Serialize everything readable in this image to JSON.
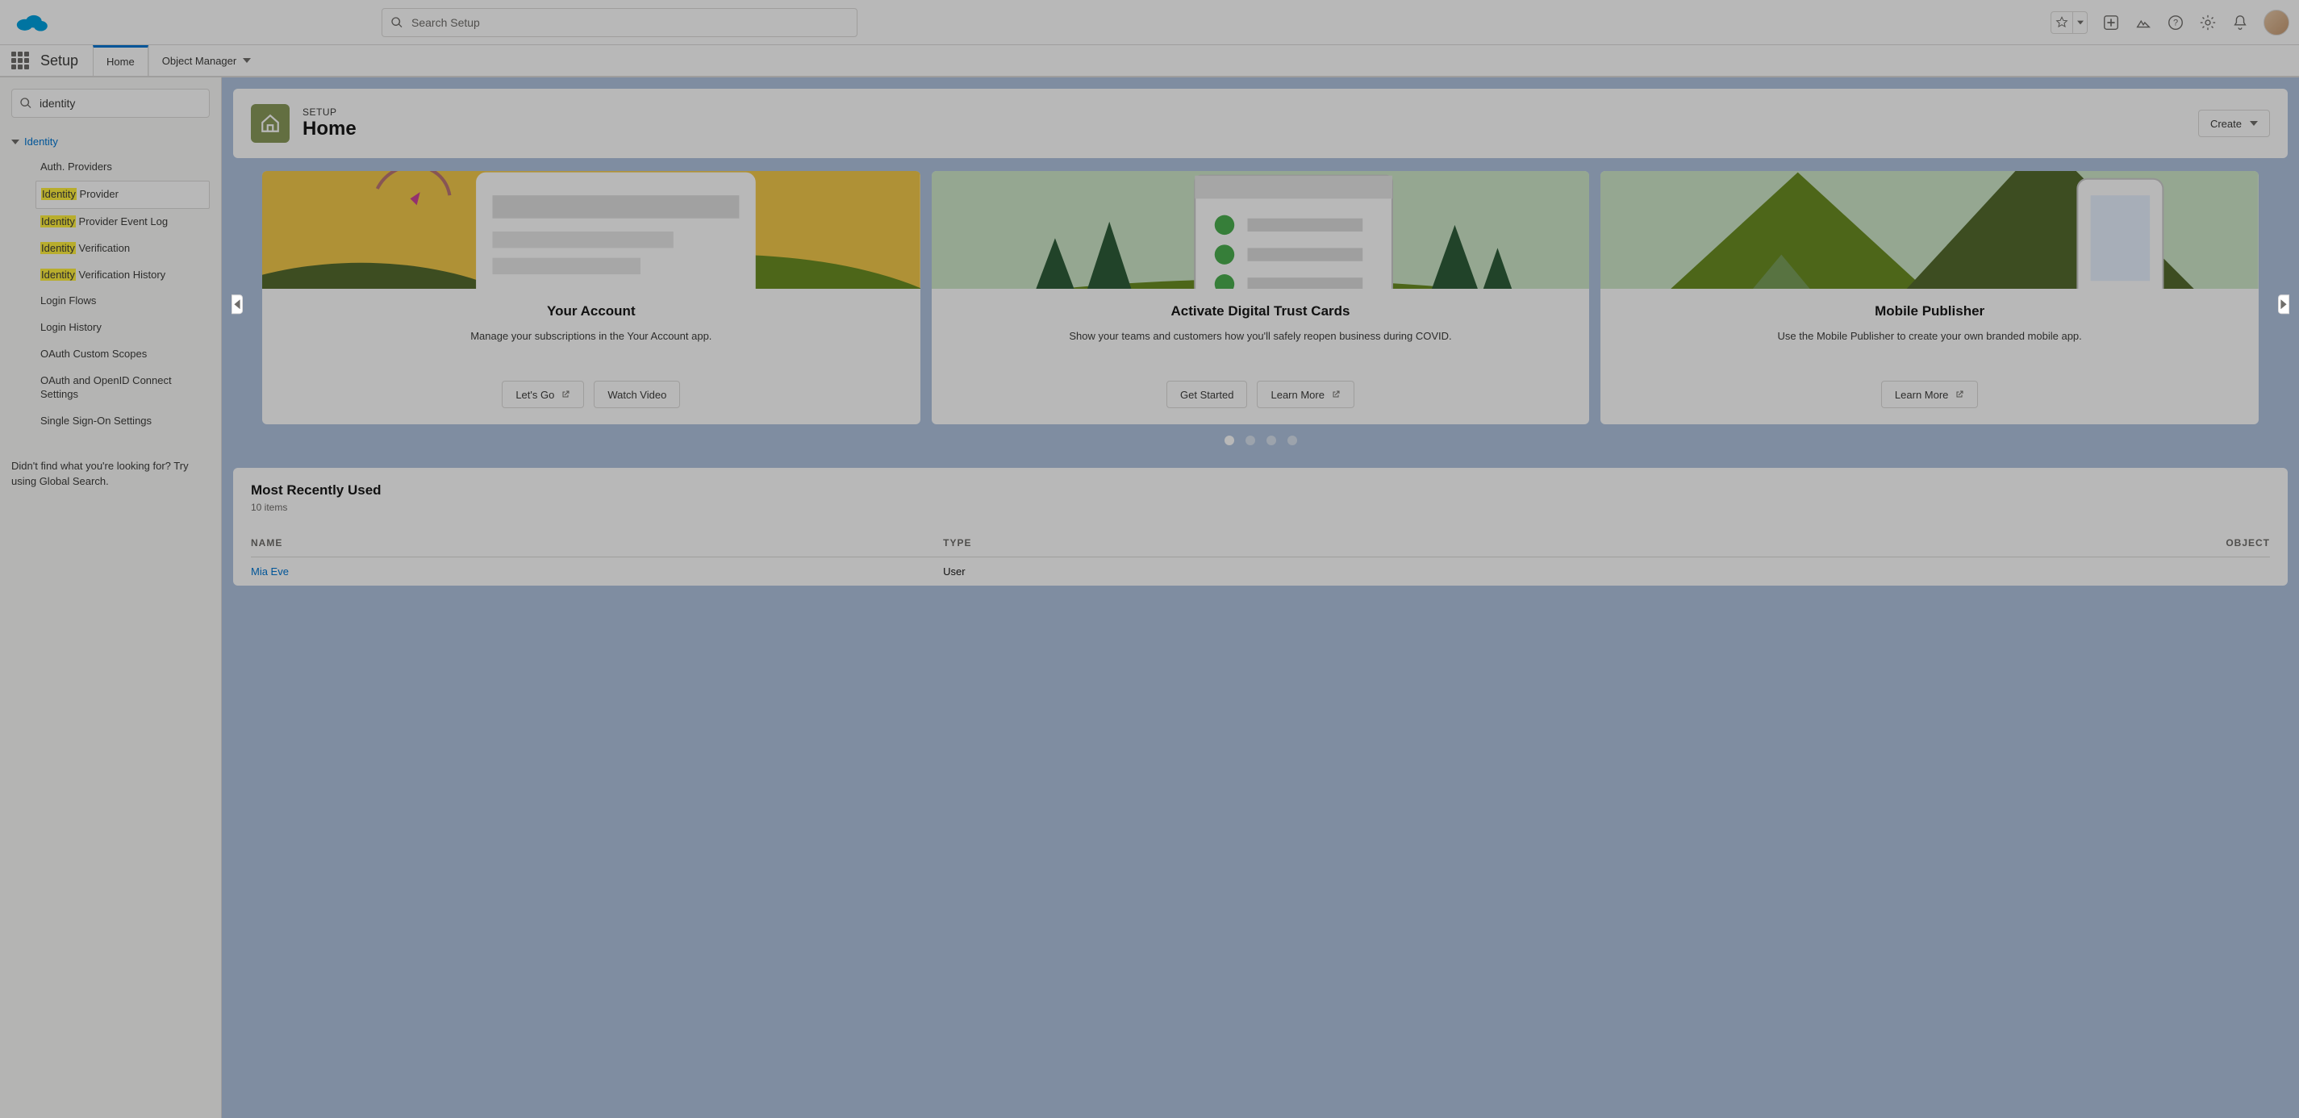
{
  "header": {
    "search_placeholder": "Search Setup"
  },
  "context": {
    "app_name": "Setup",
    "tabs": [
      {
        "label": "Home",
        "active": true
      },
      {
        "label": "Object Manager",
        "active": false,
        "has_dropdown": true
      }
    ]
  },
  "sidebar": {
    "quick_find_value": "identity",
    "root_label": "Identity",
    "highlight_token": "Identity",
    "items": [
      {
        "label": "Auth. Providers",
        "hl_prefix": "",
        "hl": "",
        "hl_suffix": "Auth. Providers"
      },
      {
        "label": "Identity Provider",
        "hl_prefix": "",
        "hl": "Identity",
        "hl_suffix": " Provider",
        "selected": true
      },
      {
        "label": "Identity Provider Event Log",
        "hl_prefix": "",
        "hl": "Identity",
        "hl_suffix": " Provider Event Log"
      },
      {
        "label": "Identity Verification",
        "hl_prefix": "",
        "hl": "Identity",
        "hl_suffix": " Verification"
      },
      {
        "label": "Identity Verification History",
        "hl_prefix": "",
        "hl": "Identity",
        "hl_suffix": " Verification History"
      },
      {
        "label": "Login Flows",
        "hl_prefix": "",
        "hl": "",
        "hl_suffix": "Login Flows"
      },
      {
        "label": "Login History",
        "hl_prefix": "",
        "hl": "",
        "hl_suffix": "Login History"
      },
      {
        "label": "OAuth Custom Scopes",
        "hl_prefix": "",
        "hl": "",
        "hl_suffix": "OAuth Custom Scopes"
      },
      {
        "label": "OAuth and OpenID Connect Settings",
        "hl_prefix": "",
        "hl": "",
        "hl_suffix": "OAuth and OpenID Connect Settings"
      },
      {
        "label": "Single Sign-On Settings",
        "hl_prefix": "",
        "hl": "",
        "hl_suffix": "Single Sign-On Settings"
      }
    ],
    "footer": "Didn't find what you're looking for? Try using Global Search."
  },
  "page_header": {
    "eyebrow": "SETUP",
    "title": "Home",
    "create_label": "Create"
  },
  "carousel": {
    "cards": [
      {
        "title": "Your Account",
        "desc": "Manage your subscriptions in the Your Account app.",
        "buttons": [
          {
            "label": "Let's Go",
            "external": true
          },
          {
            "label": "Watch Video",
            "external": false
          }
        ]
      },
      {
        "title": "Activate Digital Trust Cards",
        "desc": "Show your teams and customers how you'll safely reopen business during COVID.",
        "buttons": [
          {
            "label": "Get Started",
            "external": false
          },
          {
            "label": "Learn More",
            "external": true
          }
        ]
      },
      {
        "title": "Mobile Publisher",
        "desc": "Use the Mobile Publisher to create your own branded mobile app.",
        "buttons": [
          {
            "label": "Learn More",
            "external": true
          }
        ]
      }
    ],
    "dot_count": 4,
    "active_dot": 0
  },
  "recent": {
    "heading": "Most Recently Used",
    "count_label": "10 items",
    "columns": {
      "name": "NAME",
      "type": "TYPE",
      "object": "OBJECT"
    },
    "rows": [
      {
        "name": "Mia Eve",
        "type": "User",
        "object": ""
      }
    ]
  }
}
